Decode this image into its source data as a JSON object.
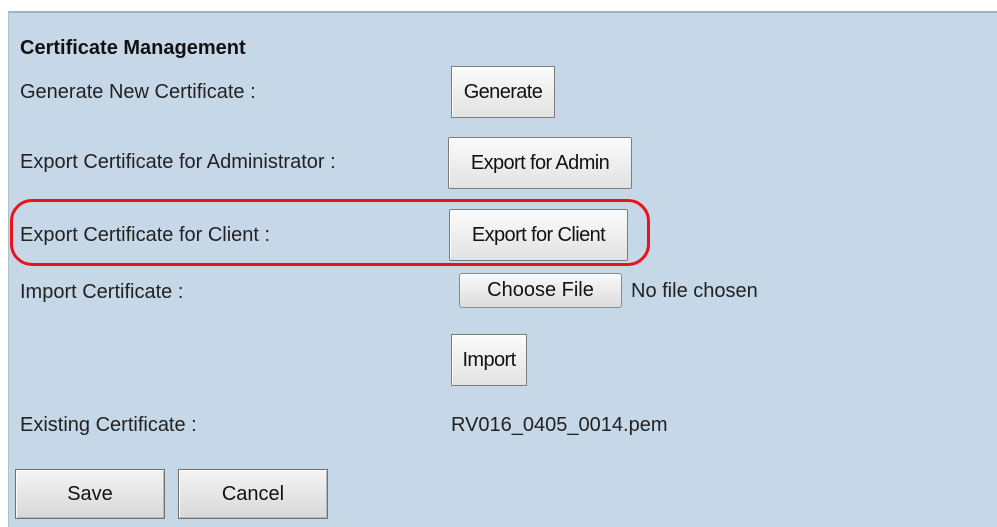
{
  "section": {
    "title": "Certificate Management"
  },
  "rows": {
    "generate": {
      "label": "Generate New Certificate :",
      "button": "Generate"
    },
    "export_admin": {
      "label": "Export Certificate for Administrator :",
      "button": "Export for Admin"
    },
    "export_client": {
      "label": "Export Certificate for Client :",
      "button": "Export for Client"
    },
    "import": {
      "label": "Import Certificate :",
      "choose_button": "Choose File",
      "file_status": "No file chosen",
      "import_button": "Import"
    },
    "existing": {
      "label": "Existing Certificate :",
      "value": "RV016_0405_0014.pem"
    }
  },
  "footer": {
    "save_label": "Save",
    "cancel_label": "Cancel"
  },
  "colors": {
    "panel_background": "#c6d7e8",
    "highlight_outline": "#e8141c"
  }
}
